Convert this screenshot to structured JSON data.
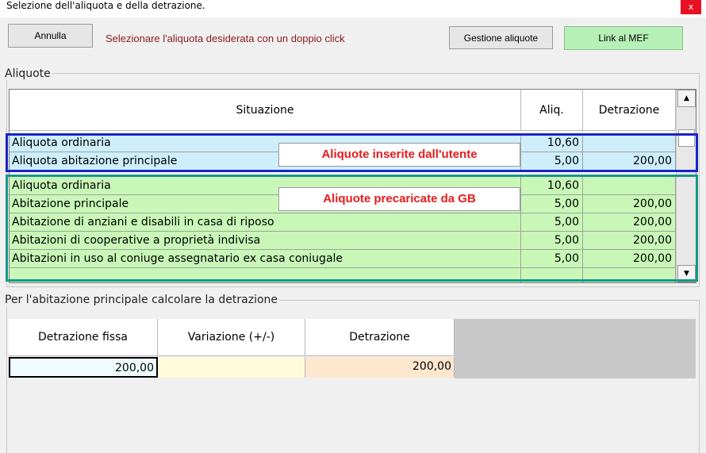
{
  "window": {
    "title": "Selezione dell'aliquota e della detrazione.",
    "close_glyph": "x"
  },
  "toolbar": {
    "annulla_label": "Annulla",
    "hint": "Selezionare l'aliquota desiderata con un doppio click",
    "gestione_label": "Gestione aliquote",
    "link_label": "Link al MEF"
  },
  "aliquote": {
    "legend": "Aliquote",
    "headers": {
      "situazione": "Situazione",
      "aliq": "Aliq.",
      "detrazione": "Detrazione"
    },
    "rows": [
      {
        "situazione": "Aliquota ordinaria",
        "aliq": "10,60",
        "detrazione": "",
        "group": "utente"
      },
      {
        "situazione": "Aliquota abitazione principale",
        "aliq": "5,00",
        "detrazione": "200,00",
        "group": "utente"
      },
      {
        "situazione": "Aliquota ordinaria",
        "aliq": "10,60",
        "detrazione": "",
        "group": "gb"
      },
      {
        "situazione": "Abitazione principale",
        "aliq": "5,00",
        "detrazione": "200,00",
        "group": "gb"
      },
      {
        "situazione": "Abitazione di anziani e disabili in casa di riposo",
        "aliq": "5,00",
        "detrazione": "200,00",
        "group": "gb"
      },
      {
        "situazione": "Abitazioni di cooperative a proprietà indivisa",
        "aliq": "5,00",
        "detrazione": "200,00",
        "group": "gb"
      },
      {
        "situazione": "Abitazioni in uso al coniuge assegnatario ex casa coniugale",
        "aliq": "5,00",
        "detrazione": "200,00",
        "group": "gb"
      }
    ],
    "callouts": {
      "utente": "Aliquote inserite dall'utente",
      "gb": "Aliquote precaricate da GB"
    },
    "scroll_up_glyph": "▲",
    "scroll_down_glyph": "▼"
  },
  "detrazione": {
    "legend": "Per l'abitazione principale calcolare la detrazione",
    "headers": {
      "fissa": "Detrazione fissa",
      "variazione": "Variazione (+/-)",
      "detrazione": "Detrazione"
    },
    "values": {
      "fissa": "200,00",
      "variazione": "",
      "detrazione": "200,00"
    }
  },
  "colors": {
    "user_rows": "#cdeefa",
    "gb_rows": "#c8f7b8",
    "user_box": "#1a23c8",
    "gb_box": "#16988a",
    "callout_text": "#e81b1b",
    "hint_text": "#8b1a1a",
    "link_button": "#b7f0b7"
  }
}
